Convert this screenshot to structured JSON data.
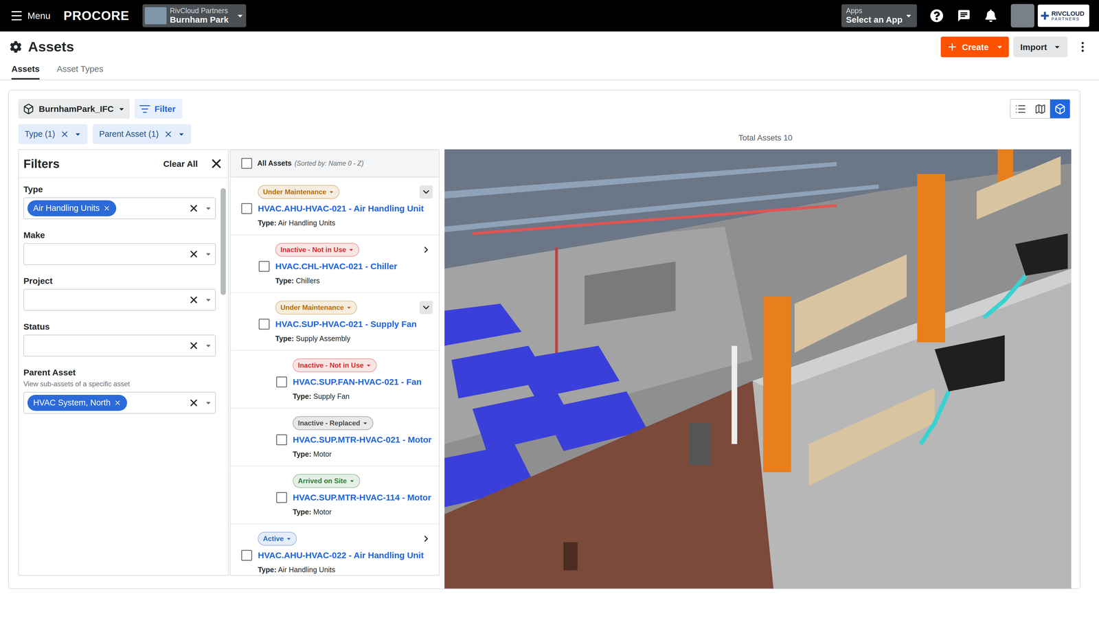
{
  "topbar": {
    "menu_label": "Menu",
    "logo": "PROCORE",
    "project": {
      "company": "RivCloud Partners",
      "name": "Burnham Park"
    },
    "apps": {
      "label": "Apps",
      "value": "Select an App"
    },
    "company_logo": {
      "line1": "RIVCLOUD",
      "line2": "PARTNERS"
    }
  },
  "page": {
    "title": "Assets",
    "create": "Create",
    "import": "Import"
  },
  "tabs": [
    {
      "label": "Assets",
      "selected": true
    },
    {
      "label": "Asset Types",
      "selected": false
    }
  ],
  "toolbar": {
    "model": "BurnhamPark_IFC",
    "filter": "Filter",
    "views": [
      {
        "kind": "list",
        "selected": false
      },
      {
        "kind": "map",
        "selected": false
      },
      {
        "kind": "model",
        "selected": true
      }
    ]
  },
  "chips": [
    {
      "label": "Type (1)"
    },
    {
      "label": "Parent Asset (1)"
    }
  ],
  "total": "Total Assets 10",
  "filters": {
    "title": "Filters",
    "clear": "Clear All",
    "fields": [
      {
        "label": "Type",
        "helper": "",
        "values": [
          "Air Handling Units"
        ]
      },
      {
        "label": "Make",
        "helper": "",
        "values": []
      },
      {
        "label": "Project",
        "helper": "",
        "values": []
      },
      {
        "label": "Status",
        "helper": "",
        "values": []
      },
      {
        "label": "Parent Asset",
        "helper": "View sub-assets of a specific asset",
        "values": [
          "HVAC System, North"
        ]
      }
    ]
  },
  "list": {
    "header": "All Assets",
    "sort": "(Sorted by: Name 0 - Z)",
    "checked": false,
    "rows": [
      {
        "status": "Under Maintenance",
        "color": "#b86e00",
        "level": 0,
        "expandable": true,
        "expanded": true,
        "checked": false,
        "name": "HVAC.AHU-HVAC-021 - Air Handling Unit",
        "type_label": "Type:",
        "type": "Air Handling Units"
      },
      {
        "status": "Inactive - Not in Use",
        "color": "#d92b2b",
        "level": 1,
        "expandable": true,
        "expanded": false,
        "checked": false,
        "name": "HVAC.CHL-HVAC-021 - Chiller",
        "type_label": "Type:",
        "type": "Chillers"
      },
      {
        "status": "Under Maintenance",
        "color": "#b86e00",
        "level": 1,
        "expandable": true,
        "expanded": true,
        "checked": false,
        "name": "HVAC.SUP-HVAC-021 - Supply Fan",
        "type_label": "Type:",
        "type": "Supply Assembly"
      },
      {
        "status": "Inactive - Not in Use",
        "color": "#d92b2b",
        "level": 2,
        "expandable": false,
        "expanded": false,
        "checked": false,
        "name": "HVAC.SUP.FAN-HVAC-021 - Fan",
        "type_label": "Type:",
        "type": "Supply Fan"
      },
      {
        "status": "Inactive - Replaced",
        "color": "#4a4a4a",
        "level": 2,
        "expandable": false,
        "expanded": false,
        "checked": false,
        "name": "HVAC.SUP.MTR-HVAC-021 - Motor",
        "type_label": "Type:",
        "type": "Motor"
      },
      {
        "status": "Arrived on Site",
        "color": "#2e7d32",
        "level": 2,
        "expandable": false,
        "expanded": false,
        "checked": false,
        "name": "HVAC.SUP.MTR-HVAC-114 - Motor",
        "type_label": "Type:",
        "type": "Motor"
      },
      {
        "status": "Active",
        "color": "#2467c7",
        "level": 0,
        "expandable": true,
        "expanded": false,
        "checked": false,
        "name": "HVAC.AHU-HVAC-022 - Air Handling Unit",
        "type_label": "Type:",
        "type": "Air Handling Units"
      }
    ]
  }
}
